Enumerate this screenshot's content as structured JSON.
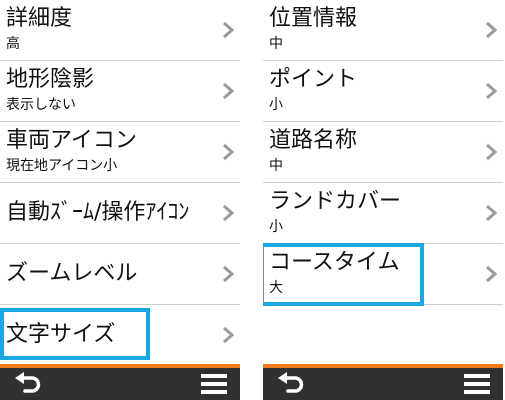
{
  "colors": {
    "highlight": "#1aa6e0",
    "accent": "#f07b1f",
    "bottom_bar": "#2f3132",
    "chevron": "#9a9a9a",
    "divider": "#cfcfcf"
  },
  "left_screen": {
    "items": [
      {
        "title": "詳細度",
        "value": "高"
      },
      {
        "title": "地形陰影",
        "value": "表示しない"
      },
      {
        "title": "車両アイコン",
        "value": "現在地アイコン小"
      },
      {
        "title": "自動ｽﾞｰﾑ/操作ｱｲｺﾝ"
      },
      {
        "title": "ズームレベル"
      },
      {
        "title": "文字サイズ"
      }
    ],
    "bottom_bar": {
      "back_icon": "back-arrow-icon",
      "menu_icon": "hamburger-menu-icon"
    }
  },
  "right_screen": {
    "items": [
      {
        "title": "位置情報",
        "value": "中"
      },
      {
        "title": "ポイント",
        "value": "小"
      },
      {
        "title": "道路名称",
        "value": "中"
      },
      {
        "title": "ランドカバー",
        "value": "小"
      },
      {
        "title": "コースタイム",
        "value": "大"
      }
    ],
    "bottom_bar": {
      "back_icon": "back-arrow-icon",
      "menu_icon": "hamburger-menu-icon"
    }
  }
}
